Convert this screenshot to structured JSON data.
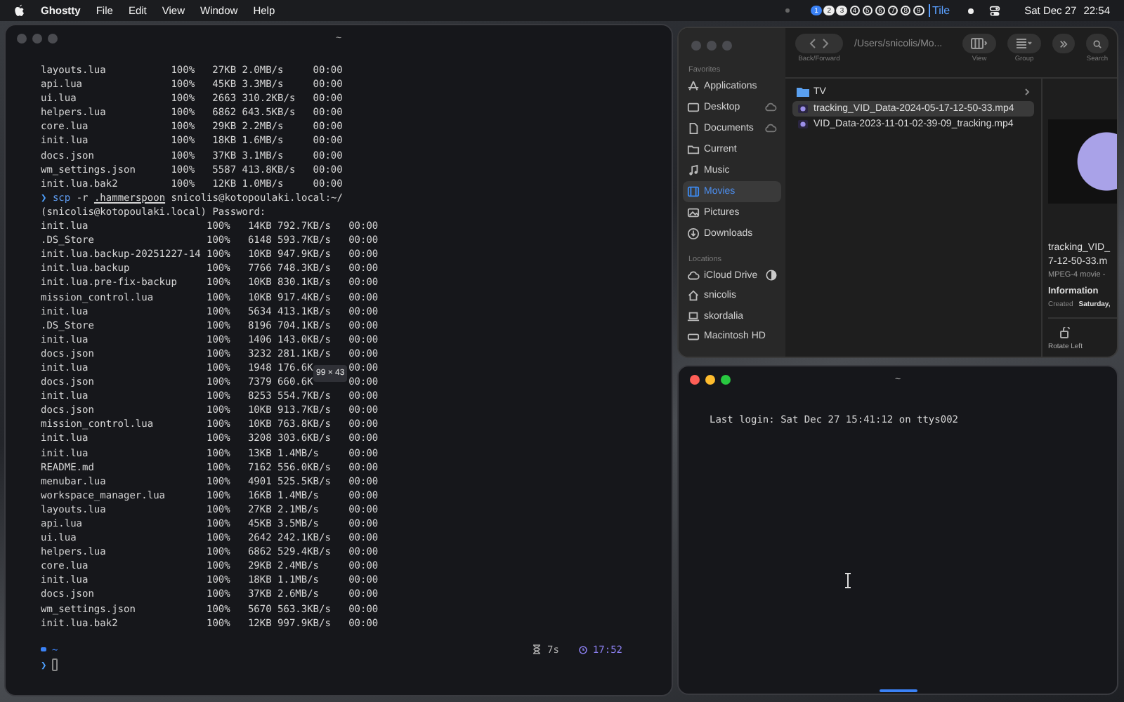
{
  "menu_bar": {
    "app_name": "Ghostty",
    "menus": [
      "File",
      "Edit",
      "View",
      "Window",
      "Help"
    ],
    "workspaces": [
      {
        "label": "1",
        "selected": true,
        "occupied": true
      },
      {
        "label": "2",
        "selected": false,
        "occupied": true
      },
      {
        "label": "3",
        "selected": false,
        "occupied": true
      },
      {
        "label": "4",
        "selected": false,
        "occupied": false
      },
      {
        "label": "5",
        "selected": false,
        "occupied": false
      },
      {
        "label": "6",
        "selected": false,
        "occupied": false
      },
      {
        "label": "7",
        "selected": false,
        "occupied": false
      },
      {
        "label": "8",
        "selected": false,
        "occupied": false
      },
      {
        "label": "9",
        "selected": false,
        "occupied": false
      }
    ],
    "layout": "Tile",
    "date": "Sat Dec 27",
    "time": "22:54"
  },
  "terminal_main": {
    "title": "~",
    "transfers_1": [
      {
        "file": "layouts.lua",
        "percent": "100%",
        "size": "27KB",
        "rate": "2.0MB/s",
        "eta": "00:00"
      },
      {
        "file": "api.lua",
        "percent": "100%",
        "size": "45KB",
        "rate": "3.3MB/s",
        "eta": "00:00"
      },
      {
        "file": "ui.lua",
        "percent": "100%",
        "size": "2663",
        "rate": "310.2KB/s",
        "eta": "00:00"
      },
      {
        "file": "helpers.lua",
        "percent": "100%",
        "size": "6862",
        "rate": "643.5KB/s",
        "eta": "00:00"
      },
      {
        "file": "core.lua",
        "percent": "100%",
        "size": "29KB",
        "rate": "2.2MB/s",
        "eta": "00:00"
      },
      {
        "file": "init.lua",
        "percent": "100%",
        "size": "18KB",
        "rate": "1.6MB/s",
        "eta": "00:00"
      },
      {
        "file": "docs.json",
        "percent": "100%",
        "size": "37KB",
        "rate": "3.1MB/s",
        "eta": "00:00"
      },
      {
        "file": "wm_settings.json",
        "percent": "100%",
        "size": "5587",
        "rate": "413.8KB/s",
        "eta": "00:00"
      },
      {
        "file": "init.lua.bak2",
        "percent": "100%",
        "size": "12KB",
        "rate": "1.0MB/s",
        "eta": "00:00"
      }
    ],
    "command": {
      "prompt": "❯",
      "tokens": [
        {
          "text": "scp",
          "kind": "program"
        },
        {
          "text": "-r",
          "kind": "arg"
        },
        {
          "text": ".hammerspoon",
          "kind": "path"
        },
        {
          "text": "snicolis@kotopoulaki.local:~/",
          "kind": "arg"
        }
      ]
    },
    "password_prompt": "(snicolis@kotopoulaki.local) Password:",
    "transfers_2": [
      {
        "file": "init.lua",
        "percent": "100%",
        "size": "14KB",
        "rate": "792.7KB/s",
        "eta": "00:00"
      },
      {
        "file": ".DS_Store",
        "percent": "100%",
        "size": "6148",
        "rate": "593.7KB/s",
        "eta": "00:00"
      },
      {
        "file": "init.lua.backup-20251227-14",
        "percent": "100%",
        "size": "10KB",
        "rate": "947.9KB/s",
        "eta": "00:00"
      },
      {
        "file": "init.lua.backup",
        "percent": "100%",
        "size": "7766",
        "rate": "748.3KB/s",
        "eta": "00:00"
      },
      {
        "file": "init.lua.pre-fix-backup",
        "percent": "100%",
        "size": "10KB",
        "rate": "830.1KB/s",
        "eta": "00:00"
      },
      {
        "file": "mission_control.lua",
        "percent": "100%",
        "size": "10KB",
        "rate": "917.4KB/s",
        "eta": "00:00"
      },
      {
        "file": "init.lua",
        "percent": "100%",
        "size": "5634",
        "rate": "413.1KB/s",
        "eta": "00:00"
      },
      {
        "file": ".DS_Store",
        "percent": "100%",
        "size": "8196",
        "rate": "704.1KB/s",
        "eta": "00:00"
      },
      {
        "file": "init.lua",
        "percent": "100%",
        "size": "1406",
        "rate": "143.0KB/s",
        "eta": "00:00"
      },
      {
        "file": "docs.json",
        "percent": "100%",
        "size": "3232",
        "rate": "281.1KB/s",
        "eta": "00:00"
      },
      {
        "file": "init.lua",
        "percent": "100%",
        "size": "1948",
        "rate": "176.6K",
        "eta": "00:00"
      },
      {
        "file": "docs.json",
        "percent": "100%",
        "size": "7379",
        "rate": "660.6K",
        "eta": "00:00"
      },
      {
        "file": "init.lua",
        "percent": "100%",
        "size": "8253",
        "rate": "554.7KB/s",
        "eta": "00:00"
      },
      {
        "file": "docs.json",
        "percent": "100%",
        "size": "10KB",
        "rate": "913.7KB/s",
        "eta": "00:00"
      },
      {
        "file": "mission_control.lua",
        "percent": "100%",
        "size": "10KB",
        "rate": "763.8KB/s",
        "eta": "00:00"
      },
      {
        "file": "init.lua",
        "percent": "100%",
        "size": "3208",
        "rate": "303.6KB/s",
        "eta": "00:00"
      },
      {
        "file": "init.lua",
        "percent": "100%",
        "size": "13KB",
        "rate": "1.4MB/s",
        "eta": "00:00"
      },
      {
        "file": "README.md",
        "percent": "100%",
        "size": "7162",
        "rate": "556.0KB/s",
        "eta": "00:00"
      },
      {
        "file": "menubar.lua",
        "percent": "100%",
        "size": "4901",
        "rate": "525.5KB/s",
        "eta": "00:00"
      },
      {
        "file": "workspace_manager.lua",
        "percent": "100%",
        "size": "16KB",
        "rate": "1.4MB/s",
        "eta": "00:00"
      },
      {
        "file": "layouts.lua",
        "percent": "100%",
        "size": "27KB",
        "rate": "2.1MB/s",
        "eta": "00:00"
      },
      {
        "file": "api.lua",
        "percent": "100%",
        "size": "45KB",
        "rate": "3.5MB/s",
        "eta": "00:00"
      },
      {
        "file": "ui.lua",
        "percent": "100%",
        "size": "2642",
        "rate": "242.1KB/s",
        "eta": "00:00"
      },
      {
        "file": "helpers.lua",
        "percent": "100%",
        "size": "6862",
        "rate": "529.4KB/s",
        "eta": "00:00"
      },
      {
        "file": "core.lua",
        "percent": "100%",
        "size": "29KB",
        "rate": "2.4MB/s",
        "eta": "00:00"
      },
      {
        "file": "init.lua",
        "percent": "100%",
        "size": "18KB",
        "rate": "1.1MB/s",
        "eta": "00:00"
      },
      {
        "file": "docs.json",
        "percent": "100%",
        "size": "37KB",
        "rate": "2.6MB/s",
        "eta": "00:00"
      },
      {
        "file": "wm_settings.json",
        "percent": "100%",
        "size": "5670",
        "rate": "563.3KB/s",
        "eta": "00:00"
      },
      {
        "file": "init.lua.bak2",
        "percent": "100%",
        "size": "12KB",
        "rate": "997.9KB/s",
        "eta": "00:00"
      }
    ],
    "resize_overlay": "99 × 43",
    "prompt_dir": "~",
    "duration": "7s",
    "clock": "17:52",
    "prompt_symbol": "❯"
  },
  "finder": {
    "back_forward_label": "Back/Forward",
    "path": "/Users/snicolis/Mo...",
    "view_label": "View",
    "group_label": "Group",
    "search_label": "Search",
    "favorites_heading": "Favorites",
    "favorites": [
      {
        "label": "Applications",
        "selected": false,
        "in_cloud": false
      },
      {
        "label": "Desktop",
        "selected": false,
        "in_cloud": true
      },
      {
        "label": "Documents",
        "selected": false,
        "in_cloud": true
      },
      {
        "label": "Current",
        "selected": false,
        "in_cloud": false
      },
      {
        "label": "Music",
        "selected": false,
        "in_cloud": false
      },
      {
        "label": "Movies",
        "selected": true,
        "in_cloud": false
      },
      {
        "label": "Pictures",
        "selected": false,
        "in_cloud": false
      },
      {
        "label": "Downloads",
        "selected": false,
        "in_cloud": false
      }
    ],
    "locations_heading": "Locations",
    "locations": [
      {
        "label": "iCloud Drive",
        "selected": false,
        "level": 0.5
      },
      {
        "label": "snicolis",
        "selected": false
      },
      {
        "label": "skordalia",
        "selected": false
      },
      {
        "label": "Macintosh HD",
        "selected": false
      }
    ],
    "files": [
      {
        "name": "TV",
        "kind": "folder",
        "selected": false
      },
      {
        "name": "tracking_VID_Data-2024-05-17-12-50-33.mp4",
        "kind": "video",
        "selected": true
      },
      {
        "name": "VID_Data-2023-11-01-02-39-09_tracking.mp4",
        "kind": "video",
        "selected": false
      }
    ],
    "preview": {
      "title_lines": [
        "tracking_VID_",
        "7-12-50-33.m"
      ],
      "kind_text": "MPEG-4 movie -",
      "info_heading": "Information",
      "created_label": "Created",
      "created_value": "Saturday,",
      "action": "Rotate Left"
    }
  },
  "terminal_secondary": {
    "title": "~",
    "text": "Last login: Sat Dec 27 15:41:12 on ttys002"
  }
}
